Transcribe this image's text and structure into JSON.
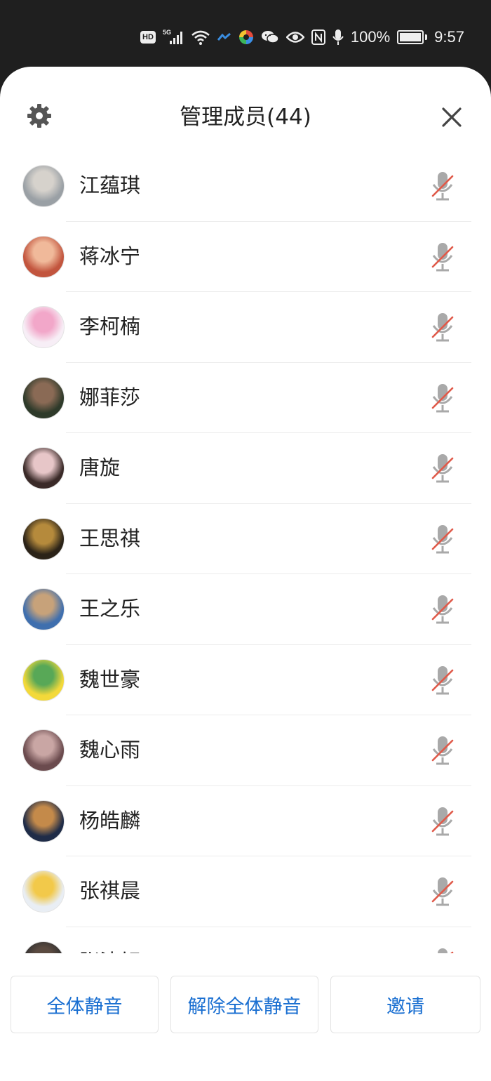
{
  "status_bar": {
    "hd": "HD",
    "network": "5G",
    "battery_percent": "100%",
    "battery_level": 1.0,
    "time": "9:57",
    "icons": [
      "hd-icon",
      "signal-5g-icon",
      "wifi-icon",
      "app-icon",
      "colorful-app-icon",
      "wechat-icon",
      "eye-icon",
      "nfc-icon",
      "mic-icon",
      "battery-icon"
    ]
  },
  "header": {
    "title": "管理成员(44)",
    "settings_icon": "gear-icon",
    "close_icon": "close-icon"
  },
  "members": [
    {
      "name": "江蕴琪",
      "muted": true,
      "avatar_colors": [
        "#9aa0a5",
        "#d6d2cc"
      ]
    },
    {
      "name": "蒋冰宁",
      "muted": true,
      "avatar_colors": [
        "#c2553e",
        "#f0b99a"
      ]
    },
    {
      "name": "李柯楠",
      "muted": true,
      "avatar_colors": [
        "#f7eef6",
        "#f2a7c9"
      ]
    },
    {
      "name": "娜菲莎",
      "muted": true,
      "avatar_colors": [
        "#2e3a2a",
        "#8a6a55"
      ]
    },
    {
      "name": "唐旋",
      "muted": true,
      "avatar_colors": [
        "#3a2a28",
        "#e7c6c8"
      ]
    },
    {
      "name": "王思祺",
      "muted": true,
      "avatar_colors": [
        "#2b2318",
        "#b58a3c"
      ]
    },
    {
      "name": "王之乐",
      "muted": true,
      "avatar_colors": [
        "#3f6fae",
        "#c7a27a"
      ]
    },
    {
      "name": "魏世豪",
      "muted": true,
      "avatar_colors": [
        "#f3d93a",
        "#58a857"
      ]
    },
    {
      "name": "魏心雨",
      "muted": true,
      "avatar_colors": [
        "#6b4b4e",
        "#c9a6a4"
      ]
    },
    {
      "name": "杨皓麟",
      "muted": true,
      "avatar_colors": [
        "#1f2c48",
        "#c48a4a"
      ]
    },
    {
      "name": "张祺晨",
      "muted": true,
      "avatar_colors": [
        "#e9eef4",
        "#f2c94a"
      ]
    },
    {
      "name": "张沈轩",
      "muted": true,
      "avatar_colors": [
        "#303030",
        "#5a4a40"
      ]
    }
  ],
  "footer": {
    "mute_all": "全体静音",
    "unmute_all": "解除全体静音",
    "invite": "邀请"
  },
  "colors": {
    "accent": "#1a6fd1",
    "mic_muted_slash": "#e05a4a",
    "mic_gray": "#a9a9a9",
    "status_bar_bg": "#1f1f1f"
  }
}
